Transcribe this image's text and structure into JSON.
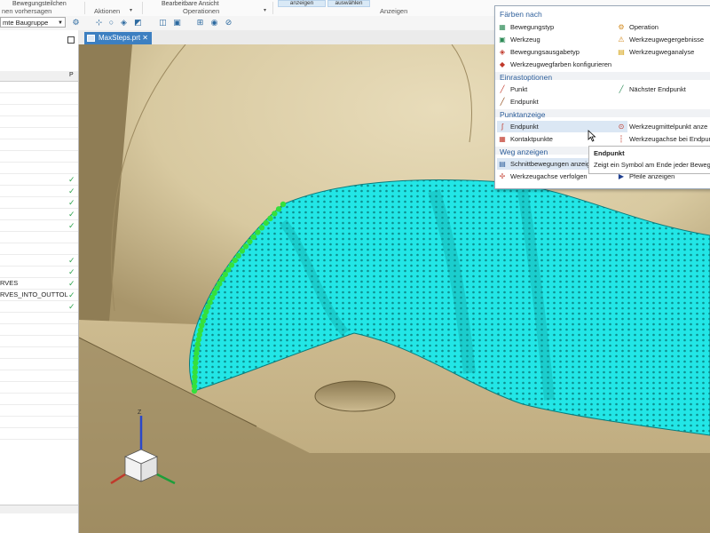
{
  "ribbon": {
    "top_row_left_label": "Bewegungsteilchen",
    "top_row_mid_label": "Bearbeitbare Ansicht",
    "btn_anzeigen": "anzeigen",
    "btn_auswaehlen": "auswählen",
    "group_vorhersagen": "nen vorhersagen",
    "group_aktionen": "Aktionen",
    "group_operationen": "Operationen",
    "group_anzeigen": "Anzeigen"
  },
  "toolbar": {
    "assembly_combo_value": "mte Baugruppe"
  },
  "left_panel": {
    "column_header": "P",
    "row_label_1": "RVES",
    "row_label_2": "RVES_INTO_OUTTOL",
    "check_mark": "✓"
  },
  "tab": {
    "title": "MaxSteps.prt",
    "close": "✕"
  },
  "menu": {
    "section_faerben": "Färben nach",
    "bewegungstyp": "Bewegungstyp",
    "operation": "Operation",
    "werkzeug": "Werkzeug",
    "werkzeugwegergebnisse": "Werkzeugwegergebnisse",
    "bewegungsausgabetyp": "Bewegungsausgabetyp",
    "werkzeugweganalyse": "Werkzeugweganalyse",
    "werkzeugwegfarben": "Werkzeugwegfarben konfigurieren",
    "section_einrast": "Einrastoptionen",
    "punkt": "Punkt",
    "naechster_endpunkt": "Nächster Endpunkt",
    "endpunkt_einrast": "Endpunkt",
    "section_punktanzeige": "Punktanzeige",
    "endpunkt_anzeige": "Endpunkt",
    "werkzeugmittelpunkt": "Werkzeugmittelpunkt anze",
    "kontaktpunkte": "Kontaktpunkte",
    "werkzeugachse_endpunk": "Werkzeugachse bei Endpun",
    "section_weg": "Weg anzeigen",
    "schnittbewegungen": "Schnittbewegungen anzeig",
    "werkzeugachse_verfolgen": "Werkzeugachse verfolgen",
    "pfeile_anzeigen": "Pfeile anzeigen"
  },
  "tooltip": {
    "title": "Endpunkt",
    "description": "Zeigt ein Symbol am Ende jeder Beweg"
  },
  "colors": {
    "toolpath": "#22e6e6",
    "part": "#c7b58b",
    "accent": "#3c7fc1",
    "section_heading": "#2e5f9b"
  }
}
